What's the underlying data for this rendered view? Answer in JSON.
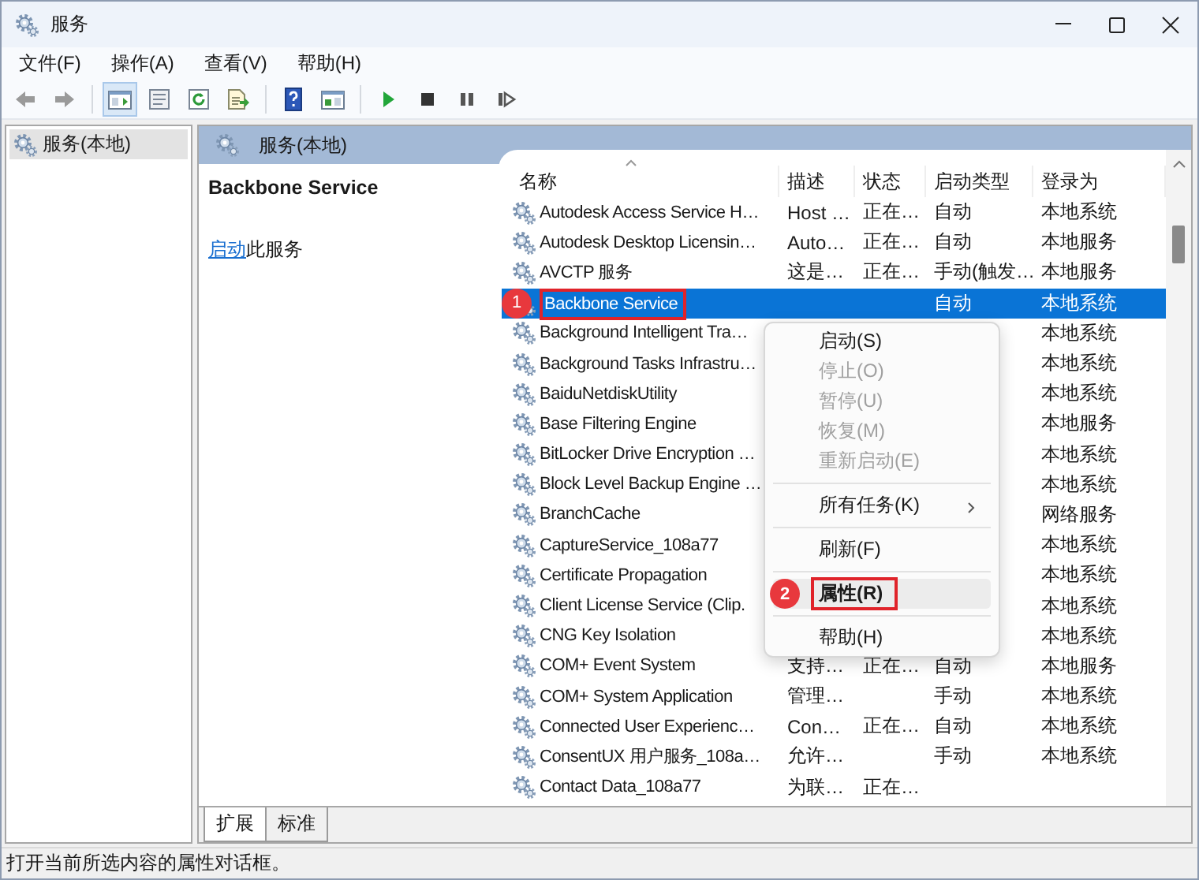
{
  "window": {
    "title": "服务"
  },
  "menu_bar": [
    "文件(F)",
    "操作(A)",
    "查看(V)",
    "帮助(H)"
  ],
  "toolbar": {
    "tree_toggle_pressed": true
  },
  "tree": [
    {
      "label": "服务(本地)",
      "selected": true
    }
  ],
  "pane_header": "服务(本地)",
  "details": {
    "title": "Backbone Service",
    "action_link": "启动",
    "action_text": "此服务"
  },
  "table": {
    "columns": [
      "名称",
      "描述",
      "状态",
      "启动类型",
      "登录为"
    ],
    "rows": [
      {
        "name": "Autodesk Access Service H…",
        "description": "Host …",
        "status": "正在…",
        "startup": "自动",
        "logon": "本地系统",
        "selected": false
      },
      {
        "name": "Autodesk Desktop Licensin…",
        "description": "Auto…",
        "status": "正在…",
        "startup": "自动",
        "logon": "本地服务",
        "selected": false
      },
      {
        "name": "AVCTP 服务",
        "description": "这是…",
        "status": "正在…",
        "startup": "手动(触发…",
        "logon": "本地服务",
        "selected": false
      },
      {
        "name": "Backbone Service",
        "startup": "自动",
        "logon": "本地系统",
        "selected": true,
        "annotation": "1"
      },
      {
        "name": "Background Intelligent Tra…",
        "logon": "本地系统",
        "selected": false
      },
      {
        "name": "Background Tasks Infrastru…",
        "logon": "本地系统",
        "selected": false
      },
      {
        "name": "BaiduNetdiskUtility",
        "logon": "本地系统",
        "selected": false
      },
      {
        "name": "Base Filtering Engine",
        "logon": "本地服务",
        "selected": false
      },
      {
        "name": "BitLocker Drive Encryption …",
        "logon": "本地系统",
        "selected": false
      },
      {
        "name": "Block Level Backup Engine …",
        "logon": "本地系统",
        "selected": false
      },
      {
        "name": "BranchCache",
        "logon": "网络服务",
        "selected": false
      },
      {
        "name": "CaptureService_108a77",
        "logon": "本地系统",
        "selected": false
      },
      {
        "name": "Certificate Propagation",
        "logon": "本地系统",
        "selected": false
      },
      {
        "name": "Client License Service (Clip.",
        "logon": "本地系统",
        "selected": false
      },
      {
        "name": "CNG Key Isolation",
        "logon": "本地系统",
        "selected": false
      },
      {
        "name": "COM+ Event System",
        "description": "支持…",
        "status": "正在…",
        "startup": "自动",
        "logon": "本地服务",
        "selected": false
      },
      {
        "name": "COM+ System Application",
        "description": "管理…",
        "startup": "手动",
        "logon": "本地系统",
        "selected": false
      },
      {
        "name": "Connected User Experienc…",
        "description": "Con…",
        "status": "正在…",
        "startup": "自动",
        "logon": "本地系统",
        "selected": false
      },
      {
        "name": "ConsentUX 用户服务_108a…",
        "description": "允许…",
        "startup": "手动",
        "logon": "本地系统",
        "selected": false
      },
      {
        "name": "Contact Data_108a77",
        "description": "为联…",
        "status": "正在…",
        "selected": false
      }
    ]
  },
  "context_menu": [
    {
      "kind": "item",
      "label": "启动(S)",
      "disabled": false,
      "selected": false
    },
    {
      "kind": "item",
      "label": "停止(O)",
      "disabled": true,
      "selected": false
    },
    {
      "kind": "item",
      "label": "暂停(U)",
      "disabled": true,
      "selected": false
    },
    {
      "kind": "item",
      "label": "恢复(M)",
      "disabled": true,
      "selected": false
    },
    {
      "kind": "item",
      "label": "重新启动(E)",
      "disabled": true,
      "selected": false
    },
    {
      "kind": "separator"
    },
    {
      "kind": "item",
      "label": "所有任务(K)",
      "disabled": false,
      "selected": false,
      "submenu": true
    },
    {
      "kind": "separator"
    },
    {
      "kind": "item",
      "label": "刷新(F)",
      "disabled": false,
      "selected": false
    },
    {
      "kind": "separator"
    },
    {
      "kind": "item",
      "label": "属性(R)",
      "disabled": false,
      "selected": true,
      "default": true,
      "annotation": "2"
    },
    {
      "kind": "separator"
    },
    {
      "kind": "item",
      "label": "帮助(H)",
      "disabled": false,
      "selected": false
    }
  ],
  "bottom_tabs": [
    {
      "label": "扩展",
      "selected": true
    },
    {
      "label": "标准",
      "selected": false
    }
  ],
  "status_bar": "打开当前所选内容的属性对话框。"
}
